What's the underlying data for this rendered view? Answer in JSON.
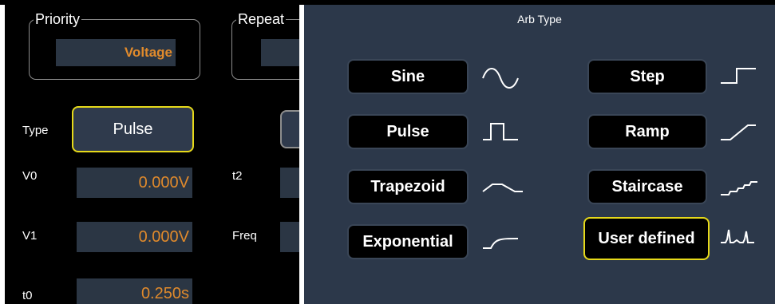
{
  "left": {
    "priority": {
      "legend": "Priority",
      "value": "Voltage"
    },
    "repeat": {
      "legend": "Repeat"
    },
    "type": {
      "label": "Type",
      "button": "Pulse"
    },
    "rows": [
      {
        "label": "V0",
        "value": "0.000V"
      },
      {
        "label": "V1",
        "value": "0.000V"
      },
      {
        "label": "t0",
        "value": "0.250s"
      }
    ],
    "right_labels": {
      "t2": "t2",
      "freq": "Freq"
    }
  },
  "arb": {
    "title": "Arb Type",
    "options": [
      {
        "label": "Sine",
        "icon": "sine-wave-icon"
      },
      {
        "label": "Pulse",
        "icon": "pulse-wave-icon"
      },
      {
        "label": "Trapezoid",
        "icon": "trapezoid-wave-icon"
      },
      {
        "label": "Exponential",
        "icon": "exponential-wave-icon"
      },
      {
        "label": "Step",
        "icon": "step-wave-icon"
      },
      {
        "label": "Ramp",
        "icon": "ramp-wave-icon"
      },
      {
        "label": "Staircase",
        "icon": "staircase-wave-icon"
      },
      {
        "label": "User defined",
        "icon": "user-defined-wave-icon"
      }
    ],
    "selected": "User defined",
    "colors": {
      "selected_border": "#e6d91a",
      "value_text": "#e08a2c",
      "panel_bg": "#2c384a"
    }
  }
}
